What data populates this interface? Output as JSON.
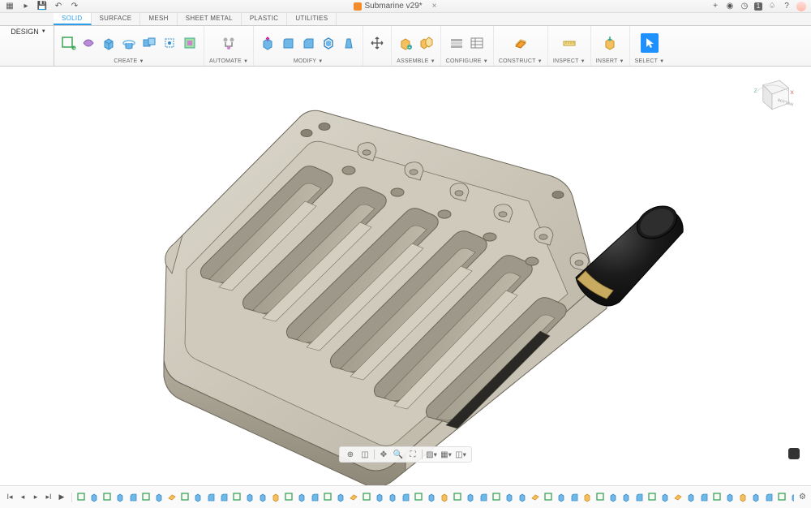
{
  "titlebar": {
    "doc_title": "Submarine v29*",
    "status_badge": "1"
  },
  "tabs": [
    "SOLID",
    "SURFACE",
    "MESH",
    "SHEET METAL",
    "PLASTIC",
    "UTILITIES"
  ],
  "active_tab": 0,
  "workspace_label": "DESIGN",
  "ribbon_groups": [
    {
      "label": "CREATE",
      "dropdown": true
    },
    {
      "label": "AUTOMATE",
      "dropdown": true
    },
    {
      "label": "MODIFY",
      "dropdown": true
    },
    {
      "label": "",
      "dropdown": false
    },
    {
      "label": "ASSEMBLE",
      "dropdown": true
    },
    {
      "label": "CONFIGURE",
      "dropdown": true
    },
    {
      "label": "CONSTRUCT",
      "dropdown": true
    },
    {
      "label": "INSPECT",
      "dropdown": true
    },
    {
      "label": "INSERT",
      "dropdown": true
    },
    {
      "label": "SELECT",
      "dropdown": true
    }
  ],
  "viewcube": {
    "face": "BOTTOM",
    "axes": [
      "Z",
      "X"
    ]
  },
  "colors": {
    "accent": "#2b9fed",
    "model_body": "#c6c1b5",
    "model_edge": "#6b6659",
    "model_dark": "#a8a294",
    "cylinder": "#1a1a1a",
    "brass": "#b89c5a"
  },
  "timeline_count": 63
}
